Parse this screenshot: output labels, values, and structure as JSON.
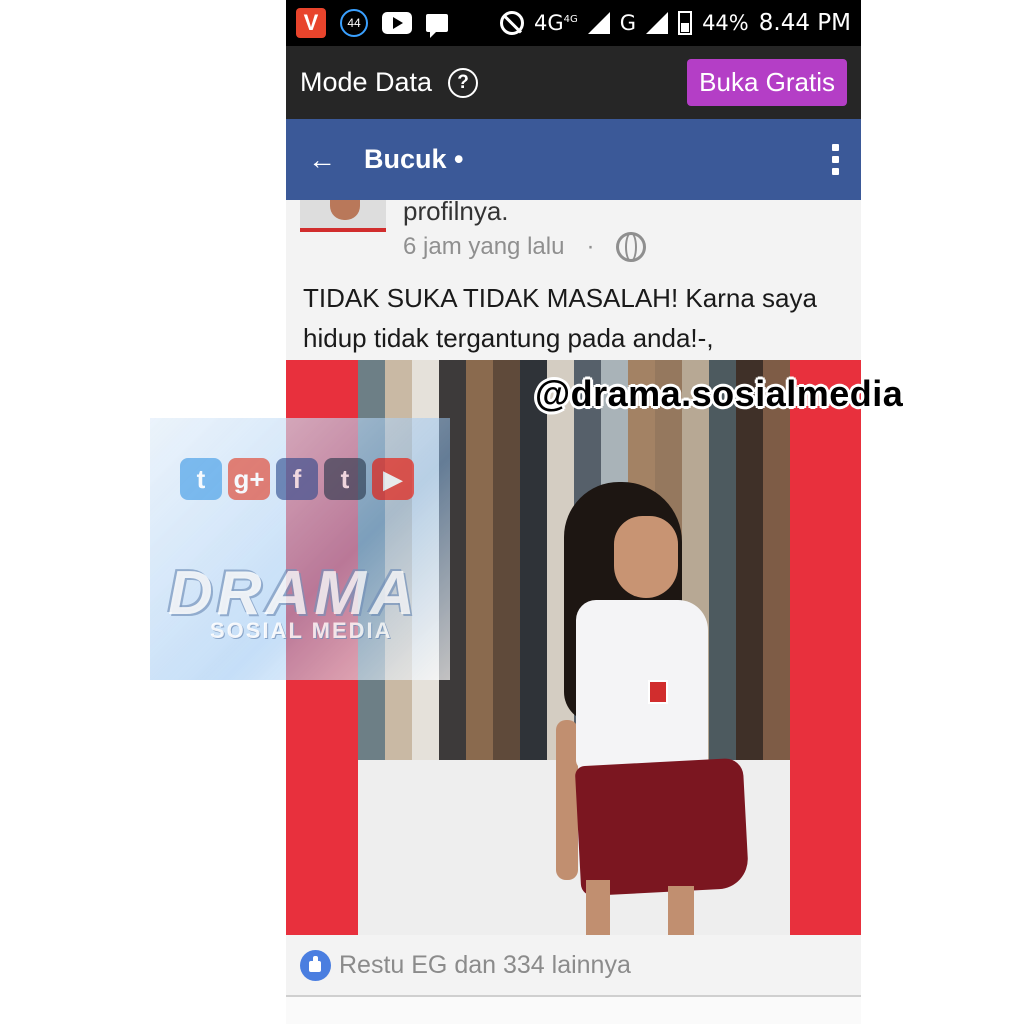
{
  "status_bar": {
    "app_badge": "V",
    "notif_count": "44",
    "network_4g": "4G",
    "network_4g_sup": "4G",
    "network_g": "G",
    "battery": "44%",
    "time": "8.44 PM"
  },
  "data_mode": {
    "title": "Mode Data",
    "help_label": "?",
    "open_free_button": "Buka Gratis"
  },
  "header": {
    "back_label": "←",
    "title": "Bucuk •"
  },
  "post": {
    "header_text": "profilnya.",
    "timestamp": "6 jam yang lalu",
    "separator": "·",
    "body": "TIDAK SUKA TIDAK MASALAH! Karna saya hidup tidak tergantung pada anda!-,"
  },
  "watermark": {
    "handle": "@drama.sosialmedia",
    "logo_title": "DRAMA",
    "logo_subtitle": "SOSIAL MEDIA",
    "logo_icons": [
      "t",
      "g+",
      "f",
      "t",
      "▶"
    ]
  },
  "reactions": {
    "likes_text": "Restu EG dan 334 lainnya"
  },
  "colors": {
    "facebook_blue": "#3b5998",
    "purple_button": "#b43ec6",
    "photo_red": "#e8303d"
  }
}
